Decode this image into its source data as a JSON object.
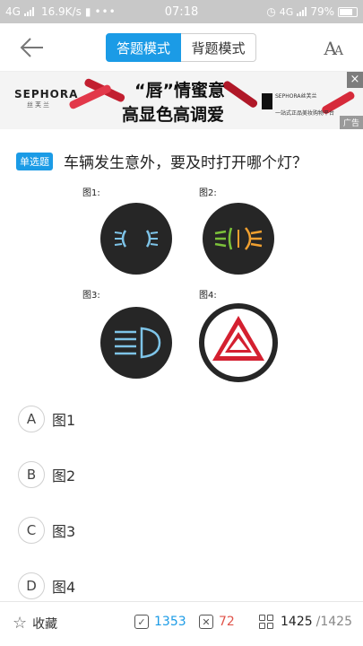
{
  "status": {
    "network": "4G",
    "speed": "16.9K/s",
    "time": "07:18",
    "network2": "4G",
    "battery": "79%"
  },
  "nav": {
    "mode_answer": "答题模式",
    "mode_recite": "背题模式",
    "font_icon": "font-size-icon"
  },
  "ad": {
    "brand": "SEPHORA",
    "brand_cn": "丝芙兰",
    "slogan1": "“唇”情蜜意",
    "slogan2": "高显色高调爱",
    "logo2_line1": "SEPHORA丝芙兰",
    "logo2_line2": "一站式正品美妆购物平台",
    "close": "×",
    "tag": "广告"
  },
  "question": {
    "type": "单选题",
    "text": "车辆发生意外，要及时打开哪个灯？",
    "figure_labels": [
      "图1:",
      "图2:",
      "图3:",
      "图4:"
    ]
  },
  "options": [
    {
      "letter": "A",
      "text": "图1"
    },
    {
      "letter": "B",
      "text": "图2"
    },
    {
      "letter": "C",
      "text": "图3"
    },
    {
      "letter": "D",
      "text": "图4"
    }
  ],
  "bottom": {
    "fav": "收藏",
    "correct": "1353",
    "wrong": "72",
    "current": "1425",
    "total": "/1425"
  },
  "colors": {
    "accent": "#1b9be6",
    "correct": "#1b9be6",
    "wrong": "#e0534a",
    "ad_red": "#d62a3a"
  }
}
